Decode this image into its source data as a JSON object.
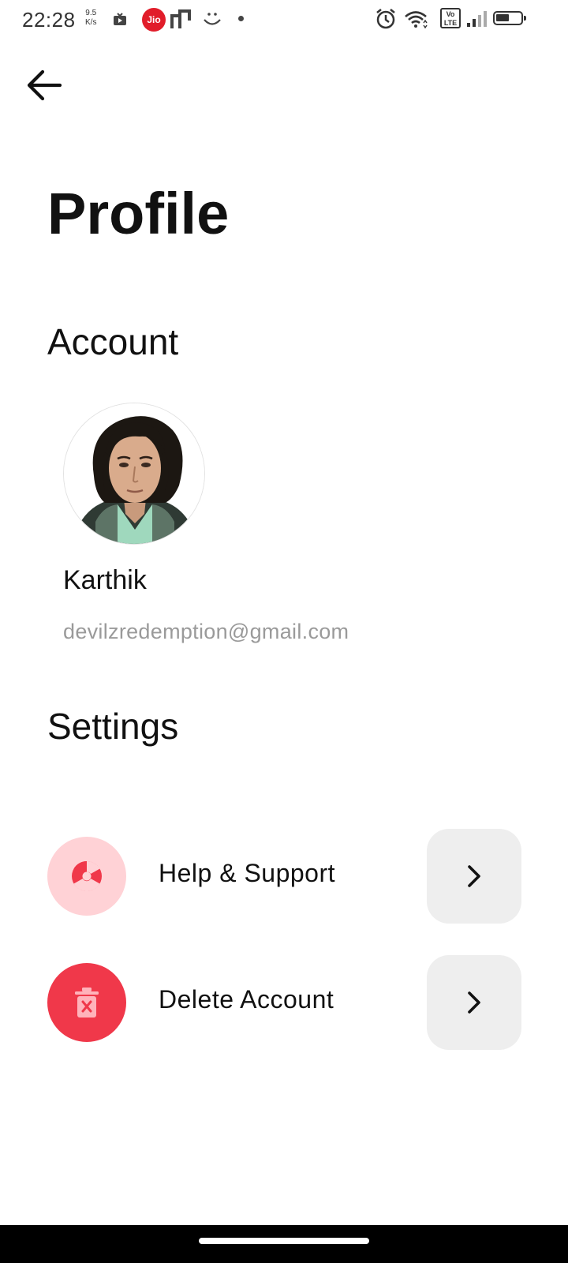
{
  "status_bar": {
    "time": "22:28",
    "net_speed_value": "9.5",
    "net_speed_unit": "K/s",
    "carrier": "Jio",
    "volte_top": "Vo",
    "volte_bottom": "LTE"
  },
  "header": {
    "title": "Profile"
  },
  "account": {
    "heading": "Account",
    "name": "Karthik",
    "email": "devilzredemption@gmail.com"
  },
  "settings": {
    "heading": "Settings",
    "items": [
      {
        "label": "Help & Support",
        "icon": "help-lifebuoy-icon",
        "icon_bg": "#ffd2d6",
        "icon_color": "#f0384a"
      },
      {
        "label": "Delete Account",
        "icon": "trash-icon",
        "icon_bg": "#f0384a",
        "icon_color": "#ffb3bb"
      }
    ]
  },
  "colors": {
    "accent": "#f0384a",
    "chevron_bg": "#eeeeee",
    "muted_text": "#9a9a9a"
  }
}
